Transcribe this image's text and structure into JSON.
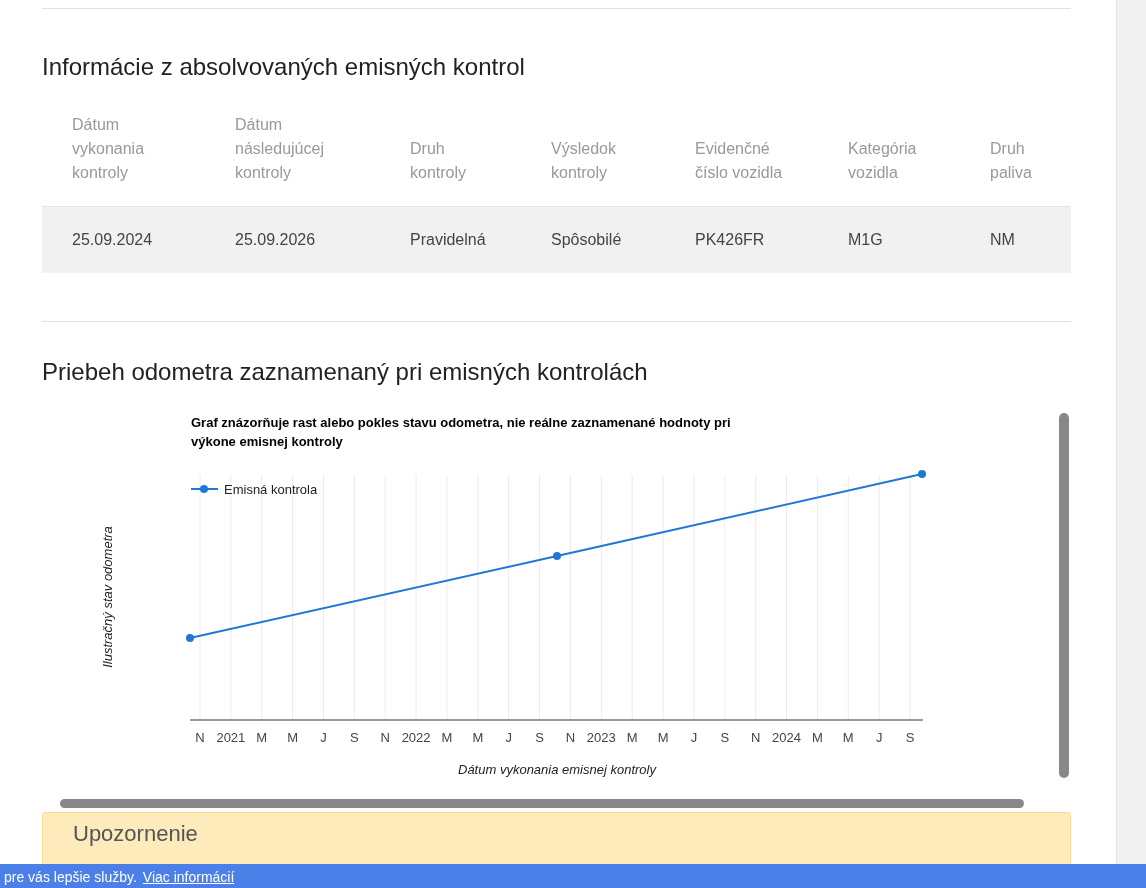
{
  "inspections": {
    "title": "Informácie z absolvovaných emisných kontrol",
    "columns": [
      "Dátum vykonania kontroly",
      "Dátum následujúcej kontroly",
      "Druh kontroly",
      "Výsledok kontroly",
      "Evidenčné číslo vozidla",
      "Kategória vozidla",
      "Druh paliva"
    ],
    "rows": [
      [
        "25.09.2024",
        "25.09.2026",
        "Pravidelná",
        "Spôsobilé",
        "PK426FR",
        "M1G",
        "NM"
      ]
    ]
  },
  "odometer": {
    "title": "Priebeh odometra zaznamenaný pri emisných kontrolách",
    "chart": {
      "title": "Graf znázorňuje rast alebo pokles stavu odometra, nie reálne zaznamenané hodnoty pri výkone emisnej kontroly",
      "legend": "Emisná kontrola",
      "xlabel": "Dátum vykonania emisnej kontroly",
      "ylabel": "Ilustračný stav odometra",
      "xtick_labels": [
        "N",
        "2021",
        "M",
        "M",
        "J",
        "S",
        "N",
        "2022",
        "M",
        "M",
        "J",
        "S",
        "N",
        "2023",
        "M",
        "M",
        "J",
        "S",
        "N",
        "2024",
        "M",
        "M",
        "J",
        "S"
      ]
    }
  },
  "notice": {
    "title": "Upozornenie"
  },
  "cookie_bar": {
    "text": "pre vás lepšie služby.",
    "link": "Viac informácií"
  }
}
